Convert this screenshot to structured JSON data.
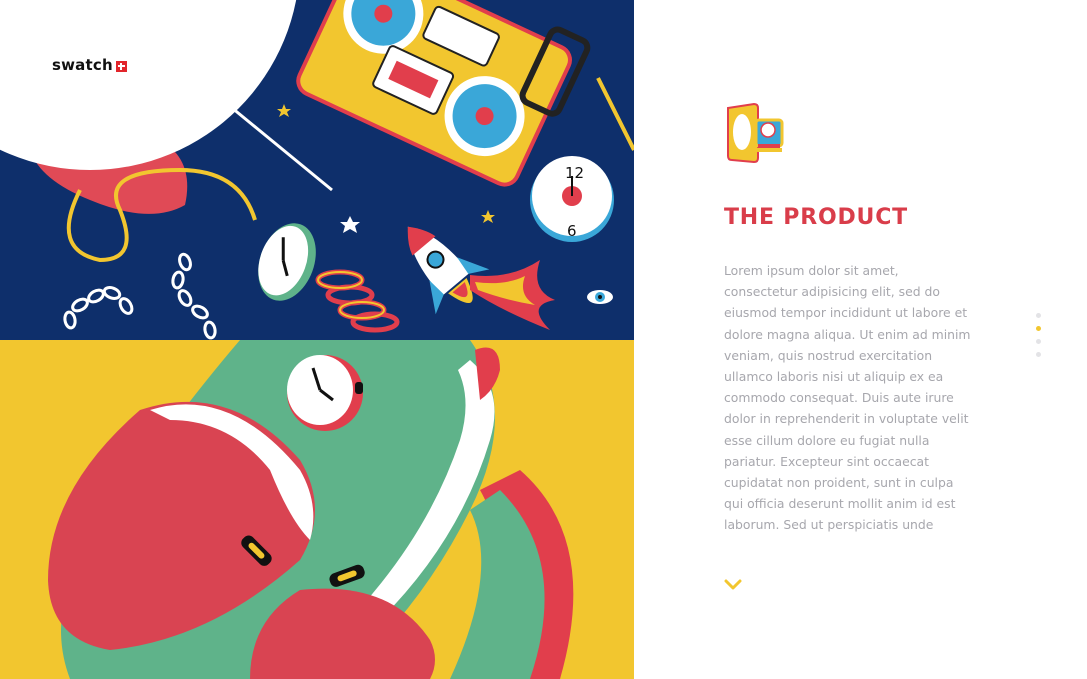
{
  "brand": {
    "name": "swatch",
    "cross_color": "#e2252b"
  },
  "colors": {
    "navy": "#0e2f6b",
    "yellow": "#f2c62f",
    "red": "#d93d4a",
    "green": "#5fb38a",
    "body_text": "#a7a7ad"
  },
  "section": {
    "icon": "product-mirror-icon",
    "title": "THE PRODUCT",
    "body": "Lorem ipsum dolor sit amet, consectetur adipisicing elit, sed do eiusmod tempor incididunt ut labore et dolore magna aliqua. Ut enim ad minim veniam, quis nostrud exercitation ullamco laboris nisi ut aliquip ex ea commodo consequat. Duis aute irure dolor in reprehenderit in voluptate velit esse cillum dolore eu fugiat nulla pariatur. Excepteur sint occaecat cupidatat non proident, sunt in culpa qui officia deserunt mollit anim id est laborum. Sed ut perspiciatis unde"
  },
  "pagination": {
    "count": 4,
    "active_index": 1
  },
  "scroll_indicator": {
    "icon": "chevron-down-icon"
  }
}
